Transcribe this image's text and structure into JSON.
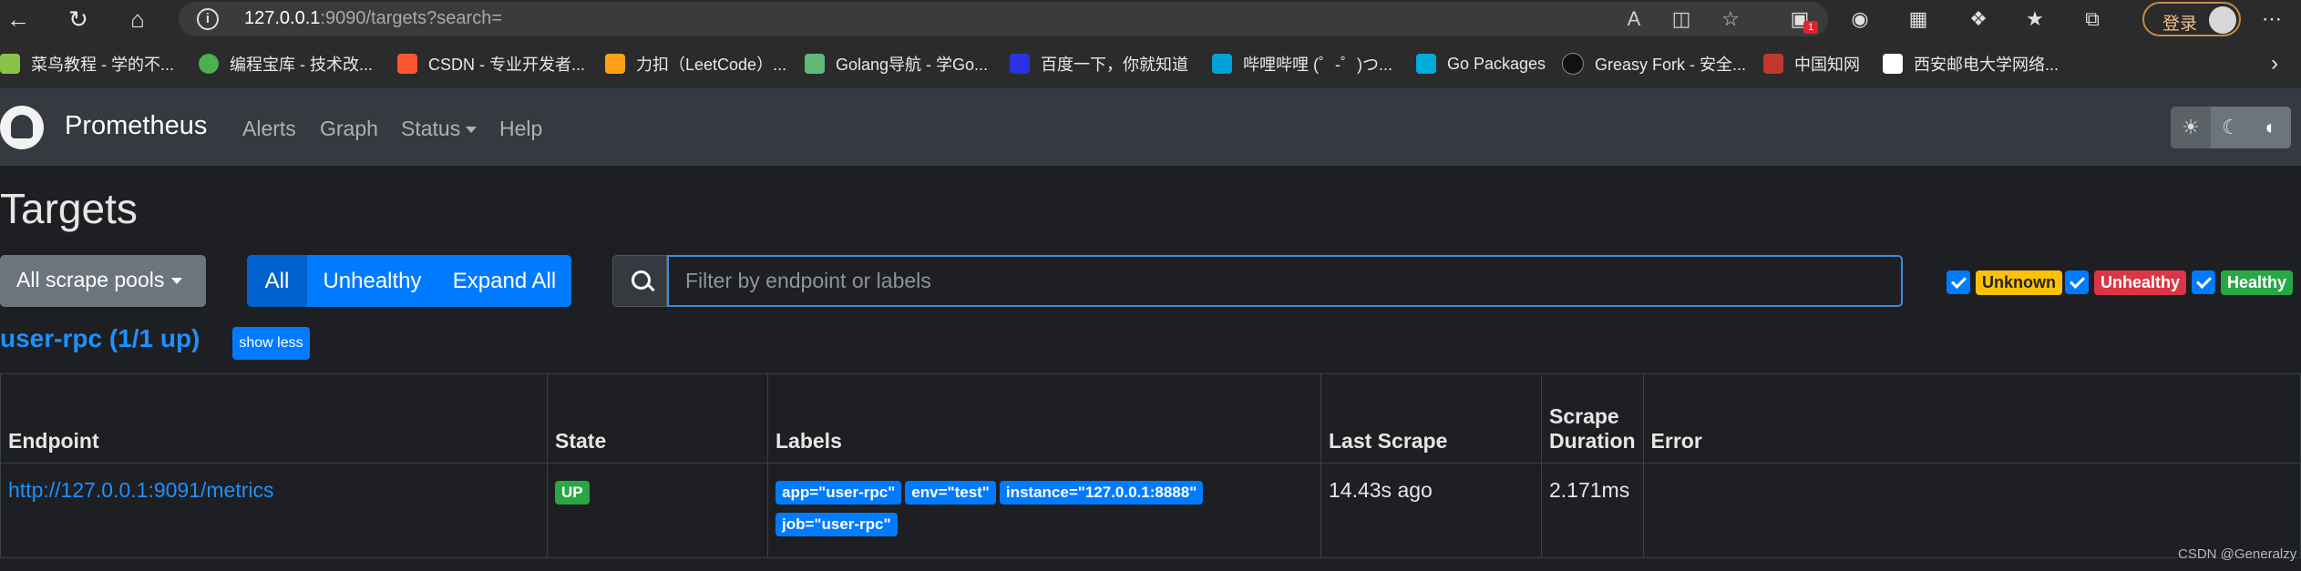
{
  "browser": {
    "url_host": "127.0.0.1",
    "url_rest": ":9090/targets?search=",
    "login_label": "登录",
    "ext_badge_count": "1",
    "bookmarks": [
      {
        "label": "菜鸟教程 - 学的不...",
        "color": "#8bc34a"
      },
      {
        "label": "编程宝库 - 技术改...",
        "color": "#4caf50"
      },
      {
        "label": "CSDN - 专业开发者...",
        "color": "#fc5531"
      },
      {
        "label": "力扣（LeetCode）...",
        "color": "#ffa116"
      },
      {
        "label": "Golang导航 - 学Go...",
        "color": "#5fb878"
      },
      {
        "label": "百度一下，你就知道",
        "color": "#2932e1"
      },
      {
        "label": "哔哩哔哩 (゜-゜)つ...",
        "color": "#00a1d6"
      },
      {
        "label": "Go Packages",
        "color": "#00add8"
      },
      {
        "label": "Greasy Fork - 安全...",
        "color": "#222222"
      },
      {
        "label": "中国知网",
        "color": "#c0392b"
      },
      {
        "label": "西安邮电大学网络...",
        "color": "#ffffff"
      }
    ]
  },
  "navbar": {
    "brand": "Prometheus",
    "links": [
      "Alerts",
      "Graph",
      "Status",
      "Help"
    ]
  },
  "page": {
    "title": "Targets",
    "pool_selector": "All scrape pools",
    "filter_buttons": [
      "All",
      "Unhealthy",
      "Expand All"
    ],
    "search_placeholder": "Filter by endpoint or labels",
    "status_filters": [
      {
        "label": "Unknown",
        "bg": "#ffc107",
        "fg": "#212529",
        "checked": true
      },
      {
        "label": "Unhealthy",
        "bg": "#dc3545",
        "fg": "#ffffff",
        "checked": true
      },
      {
        "label": "Healthy",
        "bg": "#28a745",
        "fg": "#ffffff",
        "checked": true
      }
    ],
    "pool_title": "user-rpc (1/1 up)",
    "show_less": "show less"
  },
  "table": {
    "headers": [
      "Endpoint",
      "State",
      "Labels",
      "Last Scrape",
      "Scrape Duration",
      "Error"
    ],
    "rows": [
      {
        "endpoint": "http://127.0.0.1:9091/metrics",
        "state": "UP",
        "labels": [
          "app=\"user-rpc\"",
          "env=\"test\"",
          "instance=\"127.0.0.1:8888\"",
          "job=\"user-rpc\""
        ],
        "last_scrape": "14.43s ago",
        "duration": "2.171ms",
        "error": ""
      }
    ]
  },
  "footer": "CSDN @Generalzy"
}
